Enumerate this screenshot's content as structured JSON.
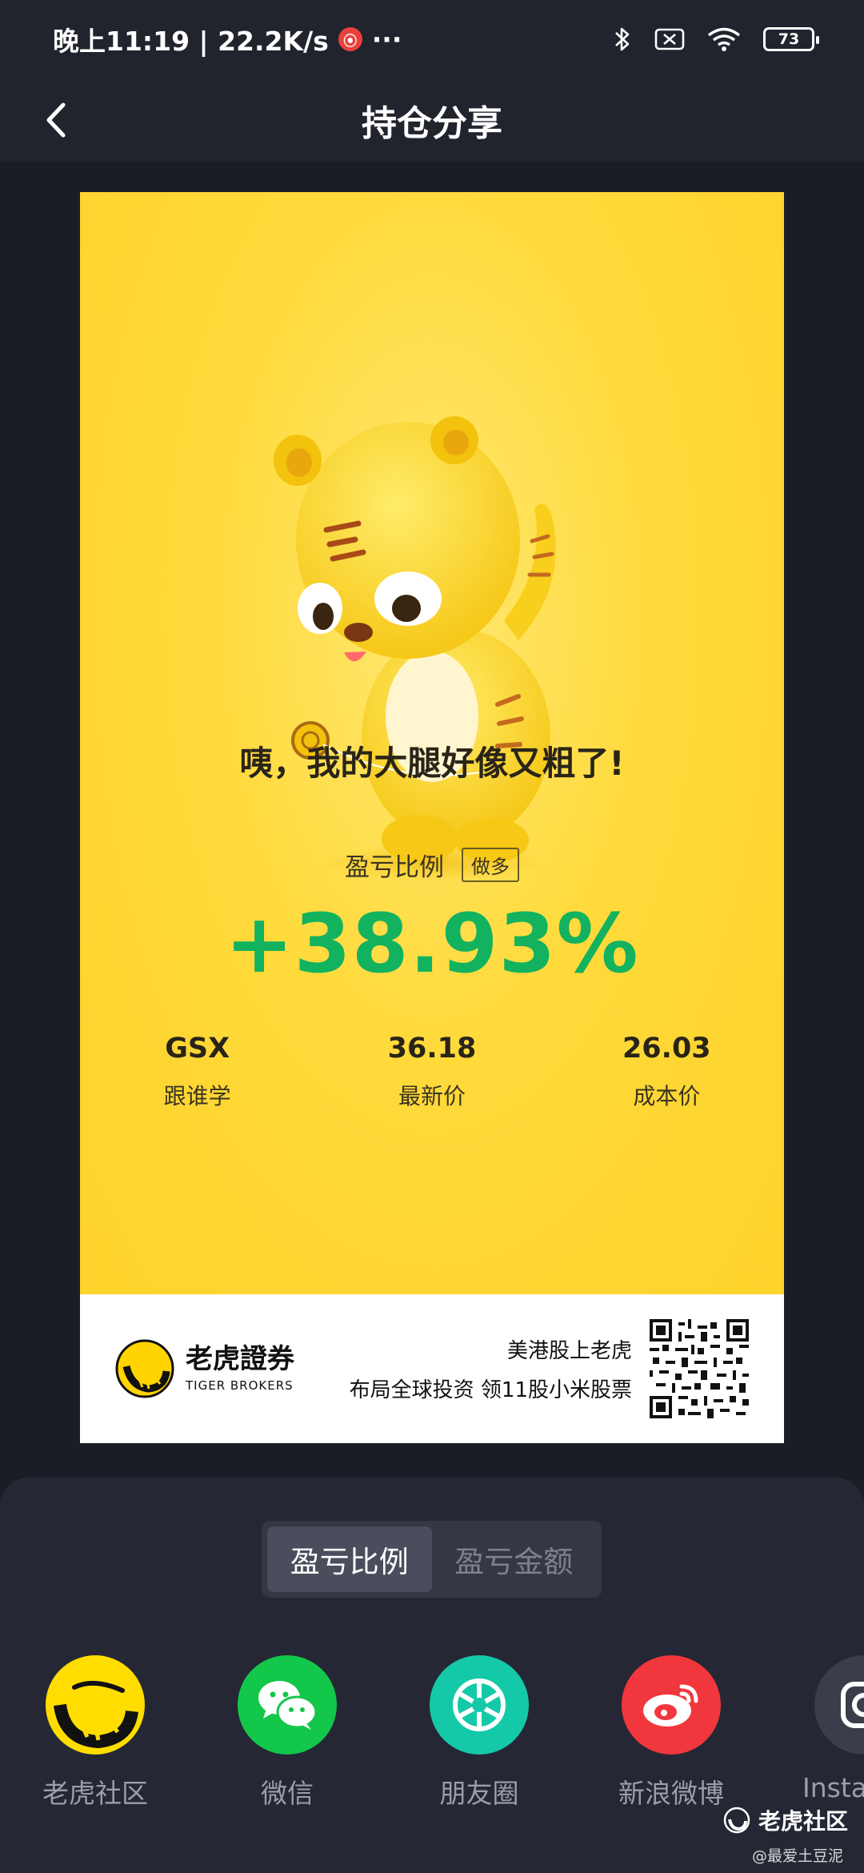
{
  "status_bar": {
    "time_speed": "晚上11:19 | 22.2K/s",
    "more": "···",
    "battery": "73"
  },
  "nav": {
    "title": "持仓分享"
  },
  "card": {
    "headline": "咦，我的大腿好像又粗了!",
    "ratio_label": "盈亏比例",
    "ratio_tag": "做多",
    "ratio_value": "+38.93%",
    "stats": [
      {
        "value": "GSX",
        "label": "跟谁学"
      },
      {
        "value": "36.18",
        "label": "最新价"
      },
      {
        "value": "26.03",
        "label": "成本价"
      }
    ],
    "footer": {
      "brand_cn": "老虎證券",
      "brand_en": "TIGER BROKERS",
      "promo_line1": "美港股上老虎",
      "promo_line2": "布局全球投资 领11股小米股票"
    }
  },
  "toggle": {
    "options": [
      "盈亏比例",
      "盈亏金额"
    ],
    "selected": "盈亏比例"
  },
  "share_targets": [
    {
      "label": "老虎社区",
      "icon": "tiger-community-icon",
      "color": "#ffdd00"
    },
    {
      "label": "微信",
      "icon": "wechat-icon",
      "color": "#12c74a"
    },
    {
      "label": "朋友圈",
      "icon": "moments-icon",
      "color": "#14c9a8"
    },
    {
      "label": "新浪微博",
      "icon": "weibo-icon",
      "color": "#f2363d"
    },
    {
      "label": "Insta",
      "icon": "instagram-icon",
      "color": "#3a3e4a"
    }
  ],
  "watermark": {
    "title": "老虎社区",
    "sub": "@最爱土豆泥"
  },
  "colors": {
    "gain": "#12b25f",
    "card_yellow": "#fdd22a",
    "background": "#1b1d26"
  }
}
